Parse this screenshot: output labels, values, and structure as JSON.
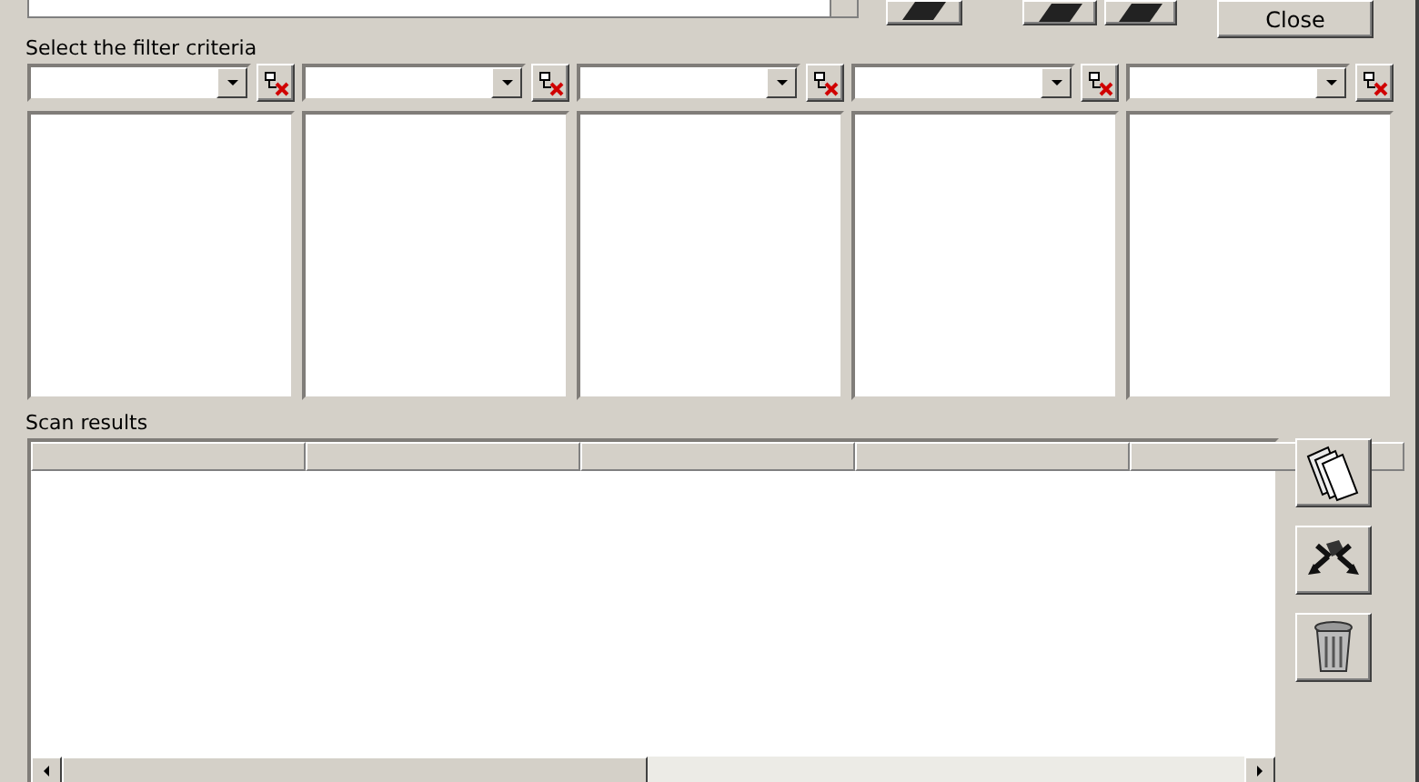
{
  "toolbar": {
    "close_button": "Close"
  },
  "filter_section": {
    "label": "Select the filter criteria",
    "filters": [
      {
        "kind": "dropdown"
      },
      {
        "kind": "dropdown"
      },
      {
        "kind": "dropdown"
      },
      {
        "kind": "dropdown"
      },
      {
        "kind": "dropdown"
      }
    ]
  },
  "results": {
    "label": "Scan results",
    "columns": [
      {
        "kind": "blank"
      },
      {
        "kind": "blank"
      },
      {
        "kind": "blank"
      },
      {
        "kind": "blank"
      },
      {
        "kind": "blank"
      }
    ]
  }
}
